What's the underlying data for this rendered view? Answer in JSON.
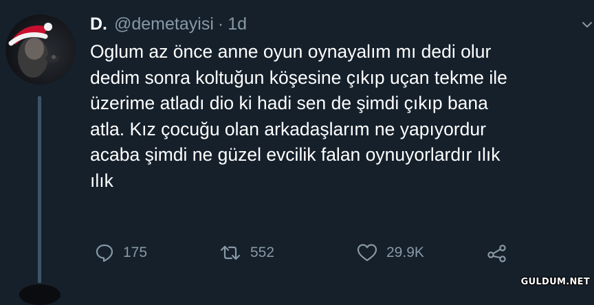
{
  "tweet": {
    "display_name": "D.",
    "handle": "@demetayisi",
    "separator": "·",
    "time": "1d",
    "text_lines": [
      "Oglum az önce anne oyun oynayalım mı dedi olur",
      "dedim sonra koltuğun köşesine çıkıp uçan tekme ile",
      "üzerime atladı dio ki hadi sen de şimdi çıkıp bana",
      "atla. Kız çocuğu olan arkadaşlarım ne yapıyordur",
      "acaba şimdi ne güzel evcilik falan oynuyorlardır ılık",
      "ılık"
    ]
  },
  "actions": {
    "reply_count": "175",
    "retweet_count": "552",
    "like_count": "29.9K"
  },
  "watermark": "GULDUM.NET",
  "colors": {
    "background": "#15202b",
    "text": "#ffffff",
    "secondary": "#8899a6",
    "thread_line": "#3d5466",
    "santa_hat": "#c8102e"
  },
  "icons": {
    "reply": "reply-icon",
    "retweet": "retweet-icon",
    "like": "heart-icon",
    "share": "share-icon",
    "more": "chevron-down-icon"
  }
}
